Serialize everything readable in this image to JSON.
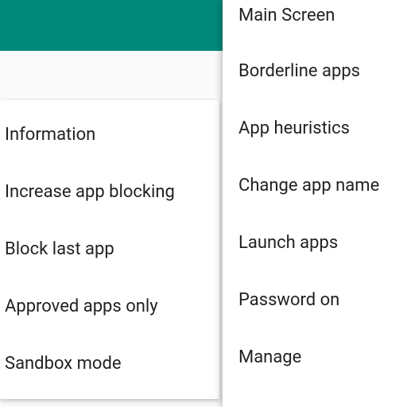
{
  "left_menu": {
    "items": [
      {
        "label": "Information"
      },
      {
        "label": "Increase app blocking"
      },
      {
        "label": "Block last app"
      },
      {
        "label": "Approved apps only"
      },
      {
        "label": "Sandbox mode"
      }
    ]
  },
  "right_menu": {
    "items": [
      {
        "label": "Main Screen"
      },
      {
        "label": "Borderline apps"
      },
      {
        "label": "App heuristics"
      },
      {
        "label": "Change app name"
      },
      {
        "label": "Launch apps"
      },
      {
        "label": "Password on"
      },
      {
        "label": "Manage"
      }
    ]
  }
}
